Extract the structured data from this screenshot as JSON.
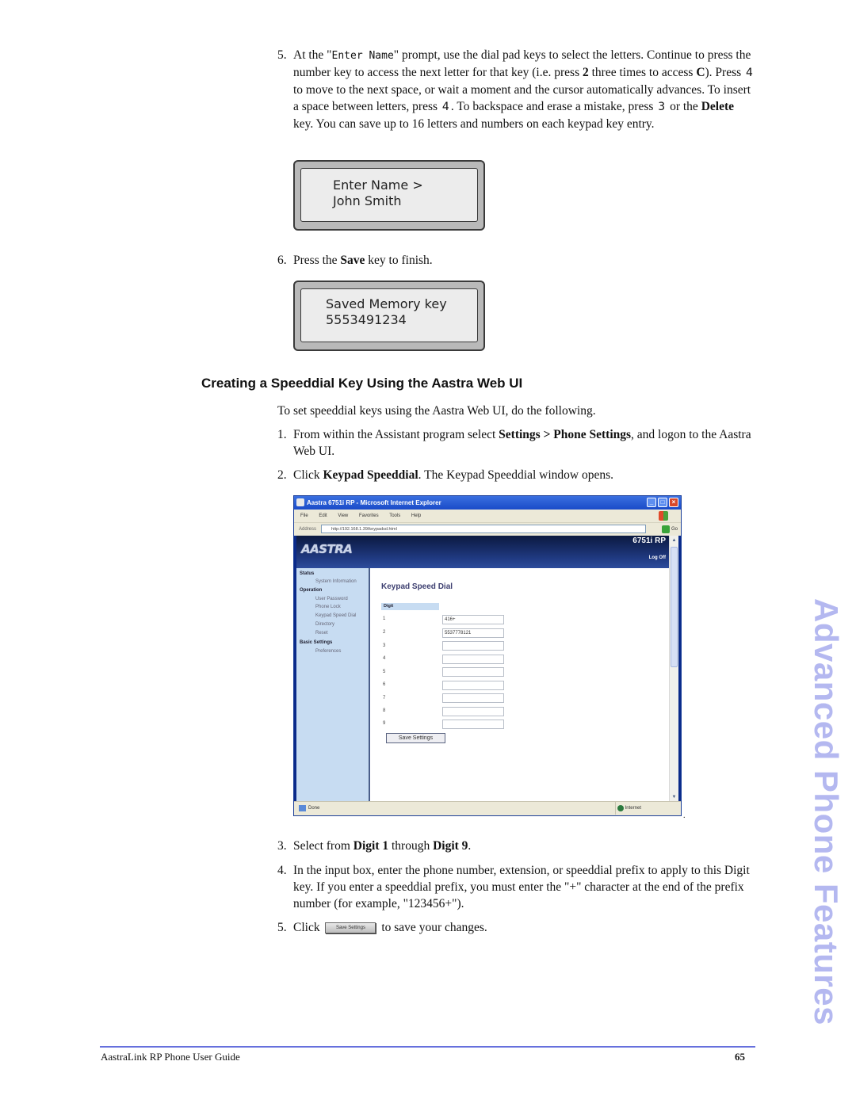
{
  "step5_top": {
    "num": "5.",
    "pre": "At the \"",
    "prompt_code": "Enter Name",
    "t1": "\" prompt, use the dial pad keys to select the letters. Continue to press the number key to access the next letter for that key (i.e. press ",
    "b1": "2",
    "t2": " three times to access ",
    "b2": "C",
    "t3": "). Press ",
    "k1": "4",
    "t4": " to move to the next space, or wait a moment and the cursor automatically advances. To insert a space between letters, press ",
    "k2": "4",
    "t5": ". To backspace and erase a mistake, press ",
    "k3": "3",
    "t6": " or the ",
    "b3": "Delete",
    "t7": " key. You can save up to 16 letters and numbers on each keypad key entry."
  },
  "lcd1": {
    "line1": "Enter Name  >",
    "line2": "John Smith"
  },
  "step6": {
    "num": "6.",
    "pre": "Press the ",
    "bold": "Save",
    "post": " key to finish."
  },
  "lcd2": {
    "line1": "Saved Memory key",
    "line2": "5553491234"
  },
  "section_heading": "Creating a Speeddial Key Using the Aastra Web UI",
  "intro": "To set speeddial keys using the Aastra Web UI, do the following.",
  "step1": {
    "num": "1.",
    "pre": "From within the Assistant program select ",
    "bold": "Settings > Phone Settings",
    "post": ", and logon to the Aastra Web UI."
  },
  "step2": {
    "num": "2.",
    "pre": "Click ",
    "bold": "Keypad Speeddial",
    "post": ". The Keypad Speeddial window opens."
  },
  "browser": {
    "title": "Aastra 6751i RP - Microsoft Internet Explorer",
    "menu": [
      "File",
      "Edit",
      "View",
      "Favorites",
      "Tools",
      "Help"
    ],
    "address_label": "Address",
    "url": "http://192.168.1.39/keypadsd.html",
    "go_label": "Go",
    "logo": "AASTRA",
    "model": "6751i RP",
    "logoff": "Log Off",
    "nav": [
      {
        "type": "header",
        "label": "Status"
      },
      {
        "type": "item",
        "label": "System Information"
      },
      {
        "type": "header",
        "label": "Operation"
      },
      {
        "type": "item",
        "label": "User Password"
      },
      {
        "type": "item",
        "label": "Phone Lock"
      },
      {
        "type": "item",
        "label": "Keypad Speed Dial"
      },
      {
        "type": "item",
        "label": "Directory"
      },
      {
        "type": "item",
        "label": "Reset"
      },
      {
        "type": "header",
        "label": "Basic Settings"
      },
      {
        "type": "item",
        "label": "Preferences"
      }
    ],
    "page_title": "Keypad Speed Dial",
    "column_header": "Digit",
    "rows": [
      {
        "digit": "1",
        "value": "416+"
      },
      {
        "digit": "2",
        "value": "5537778121"
      },
      {
        "digit": "3",
        "value": ""
      },
      {
        "digit": "4",
        "value": ""
      },
      {
        "digit": "5",
        "value": ""
      },
      {
        "digit": "6",
        "value": ""
      },
      {
        "digit": "7",
        "value": ""
      },
      {
        "digit": "8",
        "value": ""
      },
      {
        "digit": "9",
        "value": ""
      }
    ],
    "save_button": "Save Settings",
    "status_text": "Done",
    "zone_text": "Internet"
  },
  "step3": {
    "num": "3.",
    "pre": "Select from ",
    "b1": "Digit 1",
    "mid": " through ",
    "b2": "Digit 9",
    "post": "."
  },
  "step4": {
    "num": "4.",
    "text": "In the input box, enter the phone number, extension, or speeddial prefix to apply to this Digit key. If you enter a speeddial prefix, you must enter the \"+\" character at the end of the prefix number (for example, \"123456+\")."
  },
  "step5_bottom": {
    "num": "5.",
    "pre": "Click",
    "button": "Save Settings",
    "post": "to save your changes."
  },
  "side_tab": "Advanced Phone Features",
  "footer": {
    "title": "AastraLink RP Phone User Guide",
    "page": "65"
  }
}
